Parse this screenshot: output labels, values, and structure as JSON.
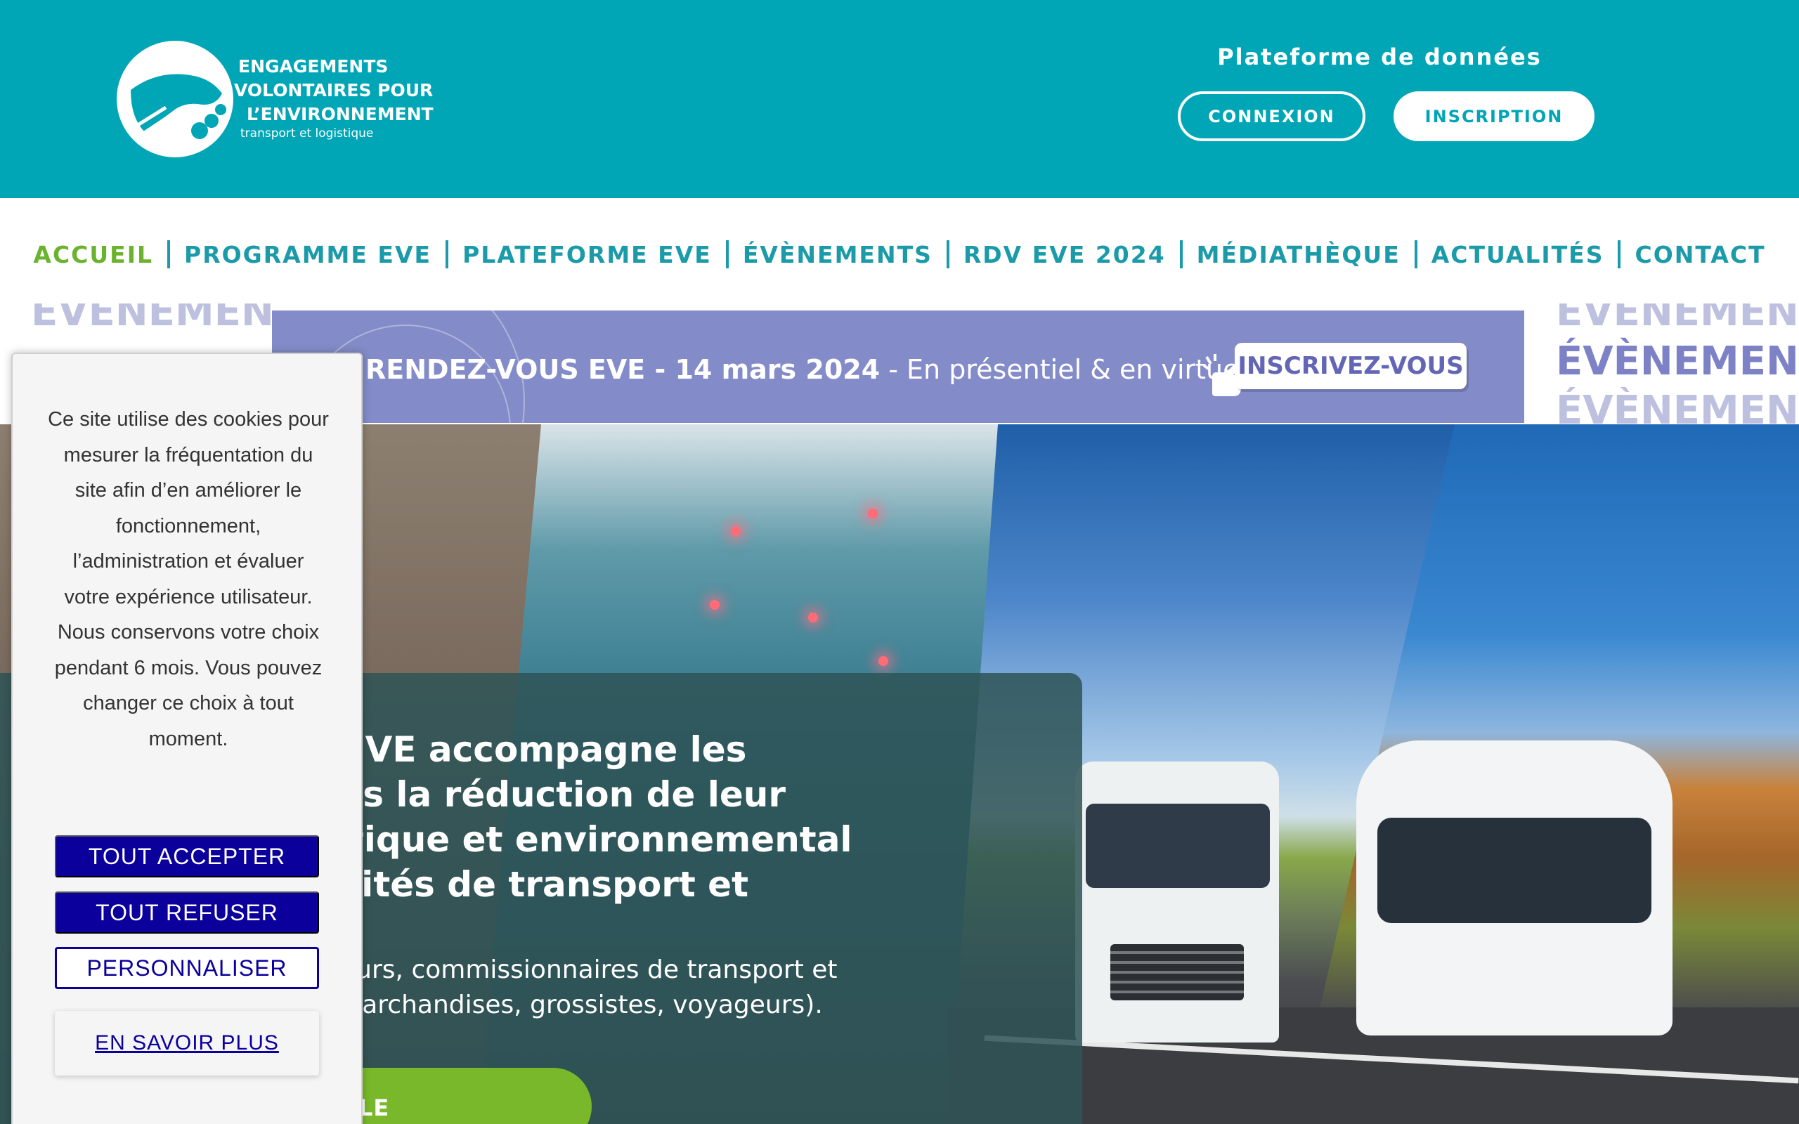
{
  "header": {
    "logo": {
      "line1": "ENGAGEMENTS",
      "line2": "VOLONTAIRES POUR",
      "line3": "L’ENVIRONNEMENT",
      "subtitle": "transport et logistique"
    },
    "platform_title": "Plateforme de données",
    "connexion_label": "CONNEXION",
    "inscription_label": "INSCRIPTION",
    "accent_color": "#00a6b6"
  },
  "nav": {
    "items": [
      {
        "label": "ACCUEIL",
        "active": true
      },
      {
        "label": "PROGRAMME EVE"
      },
      {
        "label": "PLATEFORME EVE"
      },
      {
        "label": "ÉVÈNEMENTS"
      },
      {
        "label": "RDV EVE 2024"
      },
      {
        "label": "MÉDIATHÈQUE"
      },
      {
        "label": "ACTUALITÉS"
      },
      {
        "label": "CONTACT"
      }
    ]
  },
  "banner": {
    "side_word_partial": "ÉVÈNEMENT",
    "side_word": "ÉVÈNEMENT",
    "title_bold": "RENDEZ-VOUS EVE - 14 mars 2024",
    "title_rest": " - En présentiel & en virtuel",
    "cta_label": "INSCRIVEZ-VOUS",
    "color": "#838cc8"
  },
  "hero": {
    "title": "mme EVE accompagne les\nes dans la réduction de leur\nnergétique et environnemental\ns activités de transport et\ne",
    "description": "es chargeurs, commissionnaires de transport et\noutiers (marchandises, grossistes, voyageurs).",
    "button_label": "LE PROGRAMME"
  },
  "cookie_banner": {
    "text": "Ce site utilise des cookies pour mesurer la fréquentation du site afin d’en améliorer le fonctionnement, l’administration et évaluer votre expérience utilisateur. Nous conservons votre choix pendant 6 mois. Vous pouvez changer ce choix à tout moment.",
    "accept_label": "TOUT ACCEPTER",
    "refuse_label": "TOUT REFUSER",
    "customize_label": "PERSONNALISER",
    "learn_more_label": "EN SAVOIR PLUS",
    "button_color": "#0b009c"
  }
}
